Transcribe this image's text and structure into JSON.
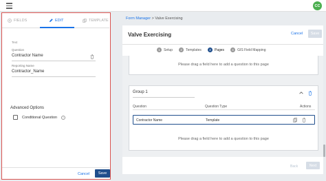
{
  "topbar": {
    "menu_icon": "hamburger-icon",
    "avatar_initials": "CC",
    "avatar_color": "#4caf50"
  },
  "breadcrumb": {
    "root": "Form Manager",
    "separator": ">",
    "current": "Valve Exercising"
  },
  "left_panel": {
    "tabs": [
      {
        "label": "FIELDS",
        "icon": "plus-circle-icon"
      },
      {
        "label": "EDIT",
        "icon": "pencil-icon"
      },
      {
        "label": "TEMPLATE",
        "icon": "copy-icon"
      }
    ],
    "active_tab": "EDIT",
    "field_type": "Text",
    "question_label": "Question",
    "question_value": "Contractor Name",
    "reporting_label": "Reporting Name",
    "reporting_value": "Contractor_Name",
    "advanced_options": "Advanced Options",
    "conditional_question": "Conditional Question",
    "cancel": "Cancel",
    "save": "Save",
    "border_color": "#d9534f"
  },
  "right_panel": {
    "title": "Valve Exercising",
    "cancel": "Cancel",
    "save": "Save",
    "steps": [
      {
        "num": "1",
        "label": "Setup"
      },
      {
        "num": "2",
        "label": "Templates"
      },
      {
        "num": "3",
        "label": "Pages"
      },
      {
        "num": "4",
        "label": "GIS Field Mapping"
      }
    ],
    "active_step": "Pages",
    "drop_text_1": "Please drag a field here to add a question to this page",
    "drop_text_2": "Please drag a field here to add a question to this page",
    "group": {
      "title": "Group 1",
      "columns": [
        "Question",
        "Question Type",
        "Actions"
      ],
      "rows": [
        {
          "question": "Contractor Name",
          "type": "Template"
        }
      ]
    },
    "back": "Back",
    "next": "Next",
    "primary_color": "#1f4e8c",
    "accent_color": "#1a73e8"
  }
}
